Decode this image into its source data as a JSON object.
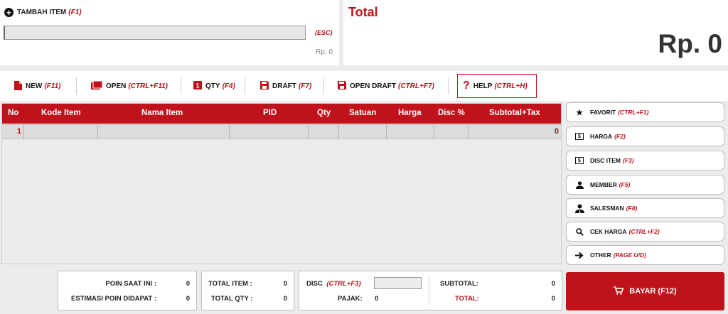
{
  "add_item": {
    "label": "TAMBAH ITEM",
    "shortcut": "(F1)",
    "input_value": "",
    "esc_label": "(ESC)",
    "price": "Rp. 0"
  },
  "total": {
    "label": "Total",
    "value": "Rp. 0"
  },
  "toolbar": {
    "new_label": "NEW",
    "new_key": "(F11)",
    "open_label": "OPEN",
    "open_key": "(CTRL+F11)",
    "qty_label": "QTY",
    "qty_key": "(F4)",
    "draft_label": "DRAFT",
    "draft_key": "(F7)",
    "open_draft_label": "OPEN DRAFT",
    "open_draft_key": "(CTRL+F7)",
    "help_label": "HELP",
    "help_key": "(CTRL+H)"
  },
  "table": {
    "columns": [
      "No",
      "Kode Item",
      "Nama Item",
      "PID",
      "Qty",
      "Satuan",
      "Harga",
      "Disc %",
      "Subtotal+Tax"
    ],
    "rows": [
      {
        "no": "1",
        "kode": "",
        "nama": "",
        "pid": "",
        "qty": "",
        "satuan": "",
        "harga": "",
        "disc": "",
        "subtotal": "0"
      }
    ]
  },
  "side": {
    "favorit_label": "FAVORIT",
    "favorit_key": "(CTRL+F1)",
    "harga_label": "HARGA",
    "harga_key": "(F2)",
    "disc_label": "DISC ITEM",
    "disc_key": "(F3)",
    "member_label": "MEMBER",
    "member_key": "(F5)",
    "salesman_label": "SALESMAN",
    "salesman_key": "(F8)",
    "cek_label": "CEK HARGA",
    "cek_key": "(CTRL+F2)",
    "other_label": "OTHER",
    "other_key": "(PAGE U/D)"
  },
  "summary": {
    "poin_label": "POIN SAAT INI :",
    "poin_value": "0",
    "estimasi_label": "ESTIMASI POIN DIDAPAT :",
    "estimasi_value": "0",
    "total_item_label": "TOTAL ITEM :",
    "total_item_value": "0",
    "total_qty_label": "TOTAL QTY :",
    "total_qty_value": "0",
    "disc_label": "DISC",
    "disc_key": "(CTRL+F3)",
    "disc_value": "",
    "pajak_label": "PAJAK:",
    "pajak_value": "0",
    "subtotal_label": "SUBTOTAL:",
    "subtotal_value": "0",
    "total_label": "TOTAL:",
    "total_value": "0"
  },
  "pay": {
    "label": "BAYAR (F12)"
  },
  "colors": {
    "accent": "#c0121b"
  },
  "icons": [
    "plus-circle-icon",
    "file-icon",
    "folder-icon",
    "qty-icon",
    "save-icon",
    "question-icon",
    "star-icon",
    "dollar-icon",
    "user-icon",
    "salesman-icon",
    "search-icon",
    "arrow-right-icon",
    "cart-icon"
  ]
}
